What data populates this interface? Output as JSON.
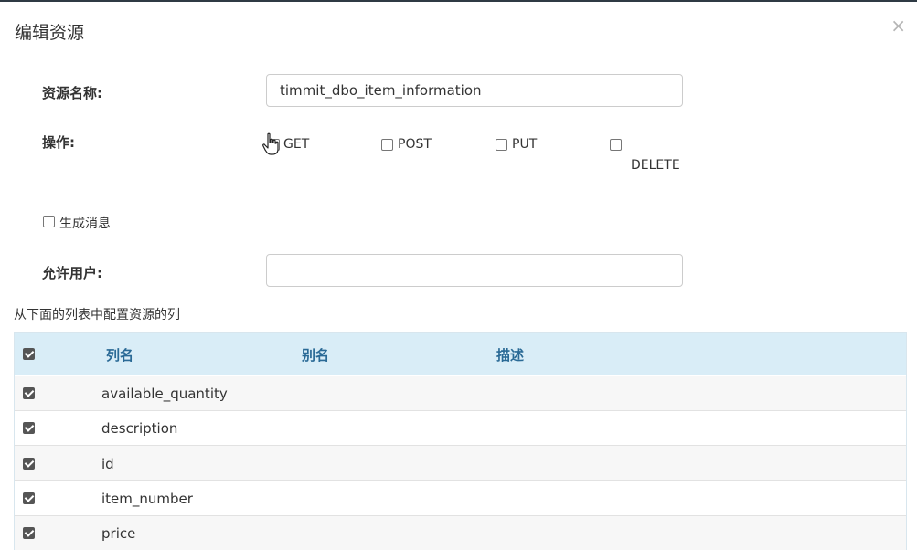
{
  "modal": {
    "title": "编辑资源",
    "close_label": "×"
  },
  "form": {
    "resource_name_label": "资源名称:",
    "resource_name_value": "timmit_dbo_item_information",
    "operations_label": "操作:",
    "operations": [
      {
        "label": "GET",
        "checked": false
      },
      {
        "label": "POST",
        "checked": false
      },
      {
        "label": "PUT",
        "checked": false
      },
      {
        "label": "DELETE",
        "checked": false
      }
    ],
    "generate_message_label": "生成消息",
    "allowed_users_label": "允许用户:",
    "allowed_users_value": ""
  },
  "table": {
    "hint": "从下面的列表中配置资源的列",
    "headers": [
      "列名",
      "别名",
      "描述"
    ],
    "rows": [
      {
        "name": "available_quantity",
        "checked": true
      },
      {
        "name": "description",
        "checked": true
      },
      {
        "name": "id",
        "checked": true
      },
      {
        "name": "item_number",
        "checked": true
      },
      {
        "name": "price",
        "checked": true
      }
    ]
  }
}
